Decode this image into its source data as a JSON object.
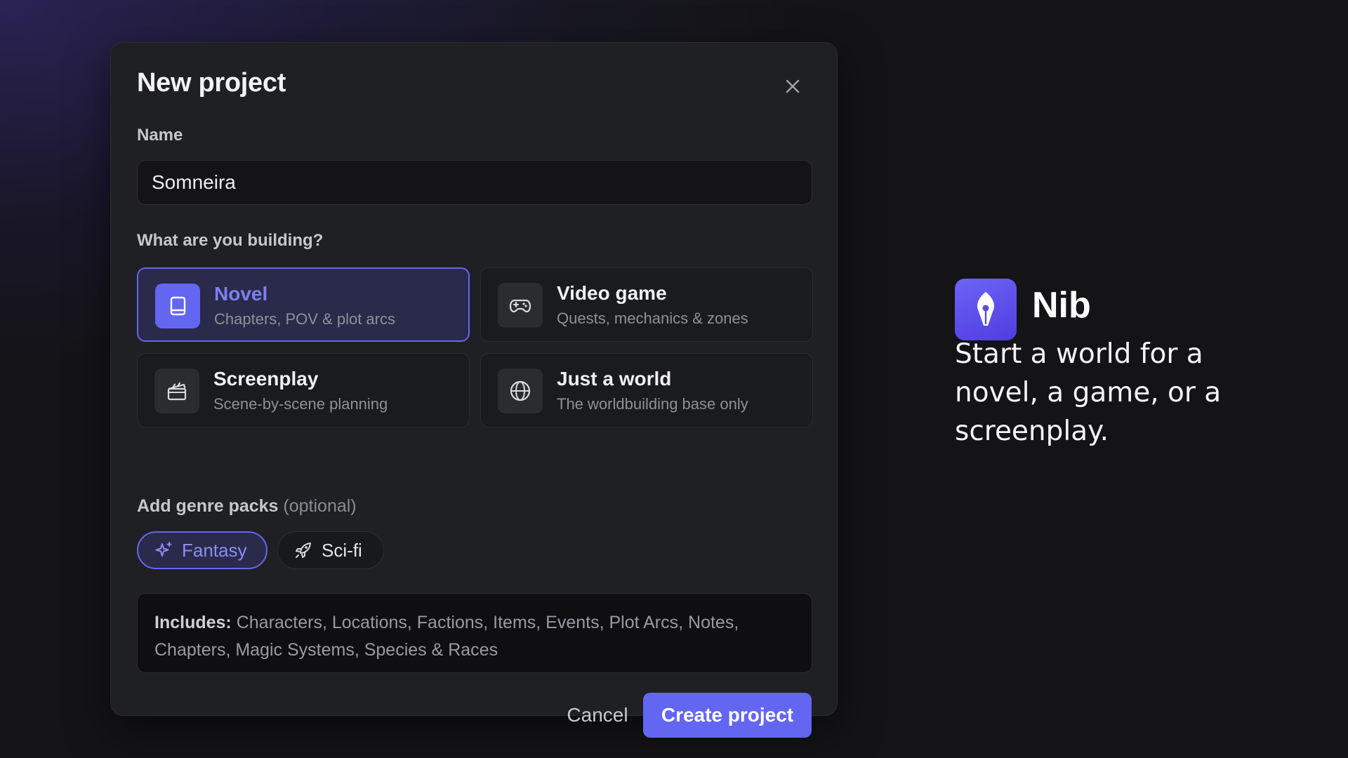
{
  "modal": {
    "title": "New project",
    "name_label": "Name",
    "name_value": "Somneira",
    "type_label": "What are you building?",
    "types": [
      {
        "title": "Novel",
        "subtitle": "Chapters, POV & plot arcs",
        "icon": "book-icon",
        "selected": true
      },
      {
        "title": "Video game",
        "subtitle": "Quests, mechanics & zones",
        "icon": "gamepad-icon",
        "selected": false
      },
      {
        "title": "Screenplay",
        "subtitle": "Scene-by-scene planning",
        "icon": "clapperboard-icon",
        "selected": false
      },
      {
        "title": "Just a world",
        "subtitle": "The worldbuilding base only",
        "icon": "globe-icon",
        "selected": false
      }
    ],
    "genre_label": "Add genre packs",
    "genre_optional": "(optional)",
    "genres": [
      {
        "label": "Fantasy",
        "icon": "sparkles-icon",
        "selected": true
      },
      {
        "label": "Sci-fi",
        "icon": "rocket-icon",
        "selected": false
      }
    ],
    "includes_label": "Includes:",
    "includes_text": "Characters, Locations, Factions, Items, Events, Plot Arcs, Notes, Chapters, Magic Systems, Species & Races",
    "cancel_label": "Cancel",
    "create_label": "Create project"
  },
  "brand": {
    "name": "Nib",
    "tagline": "Start a world for a novel, a game, or a screenplay."
  },
  "colors": {
    "accent": "#6366f1",
    "background": "#141417",
    "modal": "#1f2023"
  }
}
